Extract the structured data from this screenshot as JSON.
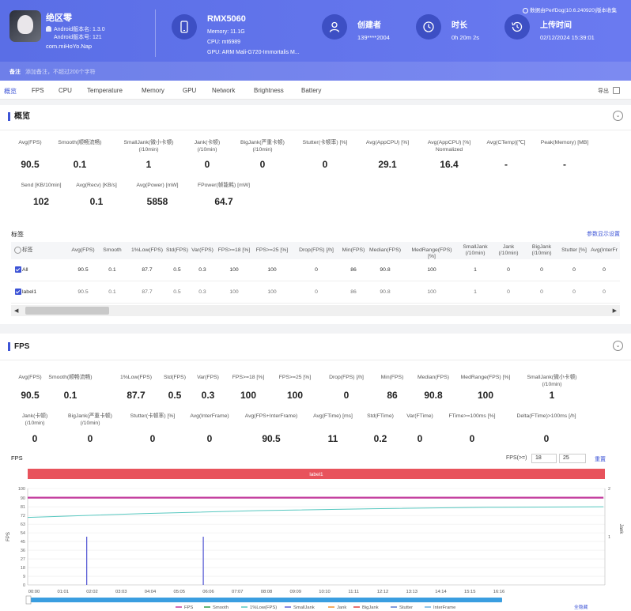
{
  "header": {
    "app_name": "绝区零",
    "android_version": "Android版本名: 1.3.0",
    "android_code": "Android版本号: 121",
    "package": "com.miHoYo.Nap",
    "device_name": "RMX5060",
    "memory": "Memory: 11.1G",
    "cpu": "CPU: mt6989",
    "gpu": "GPU: ARM Mali-G720-Immortalis M...",
    "creator_label": "创建者",
    "creator_value": "139****2004",
    "duration_label": "时长",
    "duration_value": "0h 20m 2s",
    "upload_label": "上传时间",
    "upload_value": "02/12/2024 15:39:01",
    "source": "数据由PerfDog(10.6.240920)版本收集",
    "note_label": "备注",
    "note_placeholder": "添加备注，不超过200个字符"
  },
  "tabs": [
    "概览",
    "FPS",
    "CPU",
    "Temperature",
    "Memory",
    "GPU",
    "Network",
    "Brightness",
    "Battery"
  ],
  "export_label": "导出",
  "overview": {
    "title": "概览",
    "row1": [
      {
        "label": "Avg(FPS)",
        "value": "90.5"
      },
      {
        "label": "Smooth(顺畅流畅)",
        "value": "0.1"
      },
      {
        "label": "SmallJank(微小卡顿)\n(/10min)",
        "value": "1"
      },
      {
        "label": "Jank(卡顿)\n(/10min)",
        "value": "0"
      },
      {
        "label": "BigJank(严重卡顿)\n(/10min)",
        "value": "0"
      },
      {
        "label": "Stutter(卡顿率) [%]",
        "value": "0"
      },
      {
        "label": "Avg(AppCPU) [%]",
        "value": "29.1"
      },
      {
        "label": "Avg(AppCPU) [%]\nNormalized",
        "value": "16.4"
      },
      {
        "label": "Avg(CTemp)[℃]",
        "value": "-"
      },
      {
        "label": "Peak(Memory) [MB]",
        "value": "-"
      }
    ],
    "row2": [
      {
        "label": "Send [KB/10min]",
        "value": "102"
      },
      {
        "label": "Avg(Recv) [KB/s]",
        "value": "0.1"
      },
      {
        "label": "Avg(Power) [mW]",
        "value": "5858"
      },
      {
        "label": "FPower(帧能耗) [mW]",
        "value": "64.7"
      }
    ]
  },
  "labels_section": {
    "title": "标签",
    "settings_link": "参数显示设置",
    "columns": [
      "标签",
      "Avg(FPS)",
      "Smooth",
      "1%Low(FPS)",
      "Std(FPS)",
      "Var(FPS)",
      "FPS>=18 [%]",
      "FPS>=25 [%]",
      "Drop(FPS) [/h]",
      "Min(FPS)",
      "Median(FPS)",
      "MedRange(FPS)[%]",
      "SmallJank\n(/10min)",
      "Jank\n(/10min)",
      "BigJank\n(/10min)",
      "Stutter [%]",
      "Avg(InterFr"
    ],
    "rows": [
      {
        "name": "All",
        "cells": [
          "90.5",
          "0.1",
          "87.7",
          "0.5",
          "0.3",
          "100",
          "100",
          "0",
          "86",
          "90.8",
          "100",
          "1",
          "0",
          "0",
          "0",
          "0"
        ]
      },
      {
        "name": "label1",
        "cells": [
          "90.5",
          "0.1",
          "87.7",
          "0.5",
          "0.3",
          "100",
          "100",
          "0",
          "86",
          "90.8",
          "100",
          "1",
          "0",
          "0",
          "0",
          "0"
        ]
      }
    ]
  },
  "fps_section": {
    "title": "FPS",
    "row1": [
      {
        "label": "Avg(FPS)",
        "value": "90.5"
      },
      {
        "label": "Smooth(顺畅流畅)",
        "value": "0.1"
      },
      {
        "label": "1%Low(FPS)",
        "value": "87.7"
      },
      {
        "label": "Std(FPS)",
        "value": "0.5"
      },
      {
        "label": "Var(FPS)",
        "value": "0.3"
      },
      {
        "label": "FPS>=18 [%]",
        "value": "100"
      },
      {
        "label": "FPS>=25 [%]",
        "value": "100"
      },
      {
        "label": "Drop(FPS) [/h]",
        "value": "0"
      },
      {
        "label": "Min(FPS)",
        "value": "86"
      },
      {
        "label": "Median(FPS)",
        "value": "90.8"
      },
      {
        "label": "MedRange(FPS) [%]",
        "value": "100"
      },
      {
        "label": "SmallJank(微小卡顿)\n(/10min)",
        "value": "1"
      }
    ],
    "row2": [
      {
        "label": "Jank(卡顿)\n(/10min)",
        "value": "0"
      },
      {
        "label": "BigJank(严重卡顿)\n(/10min)",
        "value": "0"
      },
      {
        "label": "Stutter(卡顿率) [%]",
        "value": "0"
      },
      {
        "label": "Avg(InterFrame)",
        "value": "0"
      },
      {
        "label": "Avg(FPS+InterFrame)",
        "value": "90.5"
      },
      {
        "label": "Avg(FTime) [ms]",
        "value": "11"
      },
      {
        "label": "Std(FTime)",
        "value": "0.2"
      },
      {
        "label": "Var(FTime)",
        "value": "0"
      },
      {
        "label": "FTime>=100ms [%]",
        "value": "0"
      },
      {
        "label": "Delta(FTime)>100ms [/h]",
        "value": "0"
      }
    ],
    "chart_title": "FPS",
    "fps_threshold_label": "FPS(>=)",
    "fps_threshold_1": "18",
    "fps_threshold_2": "25",
    "reset_link": "重置",
    "label_bar": "label1",
    "left_axis_label": "FPS",
    "right_axis_label": "Jank",
    "show_all_link": "全隐藏",
    "legend": [
      "FPS",
      "Smooth",
      "1%Low(FPS)",
      "SmallJank",
      "Jank",
      "BigJank",
      "Stutter",
      "InterFrame"
    ],
    "legend_colors": [
      "#c2389b",
      "#2e9c47",
      "#57c8c0",
      "#5b5fd6",
      "#f09030",
      "#e04040",
      "#5a7bd0",
      "#6ab0e0"
    ]
  },
  "chart_data": {
    "type": "line",
    "title": "FPS",
    "xlabel": "",
    "ylabel": "FPS",
    "y2label": "Jank",
    "ylim": [
      0,
      100
    ],
    "y2lim": [
      0,
      2
    ],
    "yticks": [
      0,
      9,
      18,
      27,
      36,
      45,
      54,
      63,
      72,
      81,
      90,
      100
    ],
    "y2ticks": [
      1,
      2
    ],
    "xticks": [
      "00:00",
      "01:01",
      "02:02",
      "03:03",
      "04:04",
      "05:05",
      "06:06",
      "07:07",
      "08:08",
      "09:09",
      "10:10",
      "11:11",
      "12:12",
      "13:13",
      "14:14",
      "15:15",
      "16:16"
    ],
    "series": [
      {
        "name": "FPS",
        "x_minutes": [
          0,
          20
        ],
        "values": [
          90.5,
          90.5
        ]
      },
      {
        "name": "1%Low(FPS)",
        "x_minutes": [
          0,
          4,
          8,
          12,
          16,
          20
        ],
        "values": [
          70,
          74,
          77,
          79,
          80.5,
          81
        ]
      },
      {
        "name": "SmallJank",
        "x_minutes": [
          2.05,
          6.1
        ],
        "values": [
          50,
          50
        ]
      }
    ]
  }
}
